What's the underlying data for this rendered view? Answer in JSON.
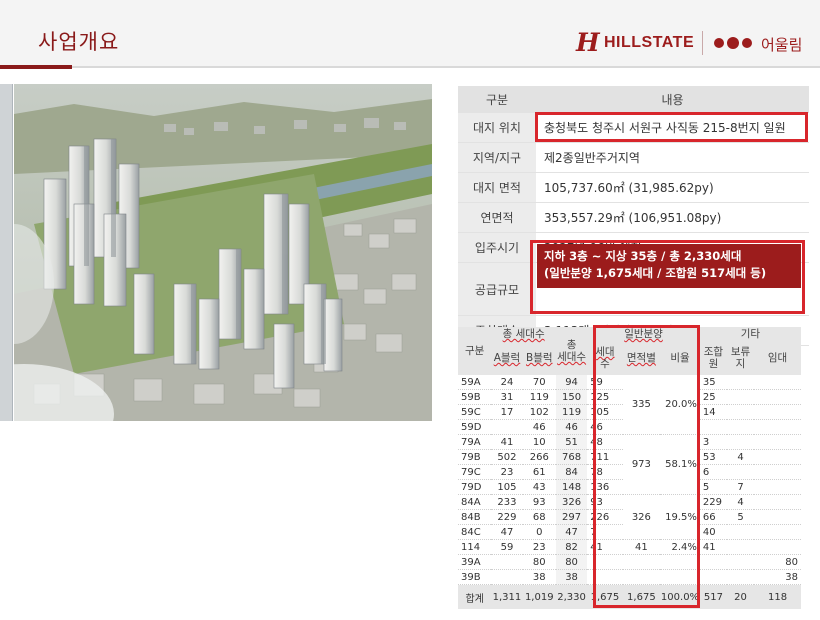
{
  "header": {
    "title": "사업개요",
    "brand_h": "H",
    "brand_name": "HILLSTATE",
    "brand_sub": "어울림",
    "brand_color": "#9c1c1c"
  },
  "info_table": {
    "head": [
      "구분",
      "내용"
    ],
    "rows": [
      {
        "label": "대지 위치",
        "value": "충청북도 청주시 서원구 사직동 215-8번지 일원"
      },
      {
        "label": "지역/지구",
        "value": "제2종일반주거지역"
      },
      {
        "label": "대지 면적",
        "value": "105,737.60㎡ (31,985.62py)"
      },
      {
        "label": "연면적",
        "value": "353,557.29㎡ (106,951.08py)"
      },
      {
        "label": "입주시기",
        "value": "2027년 06월 예정"
      },
      {
        "label": "공급규모",
        "value": "지하 3층 ~ 지상 35층 / 총 2,330세대",
        "value2": "(일반분양 1,675세대 / 조합원 517세대 등)"
      },
      {
        "label": "주차대수",
        "value": "3,113대 (세대당 1.31대)"
      }
    ]
  },
  "detail_table": {
    "head": {
      "type": "구분",
      "total_units": "총 세대수",
      "a_block": "A블럭",
      "b_block": "B블럭",
      "total": "총",
      "total2": "세대수",
      "general": "일반분양",
      "households": "세대",
      "households2": "수",
      "by_area": "면적별",
      "ratio": "비율",
      "other": "기타",
      "union": "조합",
      "union2": "원",
      "reserve": "보류",
      "reserve2": "지",
      "rental": "임대"
    },
    "rows": [
      {
        "type": "59A",
        "a": "24",
        "b": "70",
        "total": "94",
        "units": "59",
        "area": "",
        "ratio": "",
        "union": "35",
        "reserve": "",
        "rental": ""
      },
      {
        "type": "59B",
        "a": "31",
        "b": "119",
        "total": "150",
        "units": "125",
        "area": "335",
        "ratio": "20.0%",
        "union": "25",
        "reserve": "",
        "rental": ""
      },
      {
        "type": "59C",
        "a": "17",
        "b": "102",
        "total": "119",
        "units": "105",
        "area": "",
        "ratio": "",
        "union": "14",
        "reserve": "",
        "rental": ""
      },
      {
        "type": "59D",
        "a": "",
        "b": "46",
        "total": "46",
        "units": "46",
        "area": "",
        "ratio": "",
        "union": "",
        "reserve": "",
        "rental": ""
      },
      {
        "type": "79A",
        "a": "41",
        "b": "10",
        "total": "51",
        "units": "48",
        "area": "",
        "ratio": "",
        "union": "3",
        "reserve": "",
        "rental": ""
      },
      {
        "type": "79B",
        "a": "502",
        "b": "266",
        "total": "768",
        "units": "711",
        "area": "973",
        "ratio": "58.1%",
        "union": "53",
        "reserve": "4",
        "rental": ""
      },
      {
        "type": "79C",
        "a": "23",
        "b": "61",
        "total": "84",
        "units": "78",
        "area": "",
        "ratio": "",
        "union": "6",
        "reserve": "",
        "rental": ""
      },
      {
        "type": "79D",
        "a": "105",
        "b": "43",
        "total": "148",
        "units": "136",
        "area": "",
        "ratio": "",
        "union": "5",
        "reserve": "7",
        "rental": ""
      },
      {
        "type": "84A",
        "a": "233",
        "b": "93",
        "total": "326",
        "units": "93",
        "area": "",
        "ratio": "",
        "union": "229",
        "reserve": "4",
        "rental": ""
      },
      {
        "type": "84B",
        "a": "229",
        "b": "68",
        "total": "297",
        "units": "226",
        "area": "326",
        "ratio": "19.5%",
        "union": "66",
        "reserve": "5",
        "rental": ""
      },
      {
        "type": "84C",
        "a": "47",
        "b": "0",
        "total": "47",
        "units": "7",
        "area": "",
        "ratio": "",
        "union": "40",
        "reserve": "",
        "rental": ""
      },
      {
        "type": "114",
        "a": "59",
        "b": "23",
        "total": "82",
        "units": "41",
        "area": "41",
        "ratio": "2.4%",
        "union": "41",
        "reserve": "",
        "rental": ""
      },
      {
        "type": "39A",
        "a": "",
        "b": "80",
        "total": "80",
        "units": "",
        "area": "",
        "ratio": "",
        "union": "",
        "reserve": "",
        "rental": "80"
      },
      {
        "type": "39B",
        "a": "",
        "b": "38",
        "total": "38",
        "units": "",
        "area": "",
        "ratio": "",
        "union": "",
        "reserve": "",
        "rental": "38"
      }
    ],
    "total_row": {
      "type": "합계",
      "a": "1,311",
      "b": "1,019",
      "total": "2,330",
      "units": "1,675",
      "area": "1,675",
      "ratio": "100.0%",
      "union": "517",
      "reserve": "20",
      "rental": "118"
    }
  },
  "colors": {
    "highlight_border": "#d8262c",
    "supply_fill": "#9c1c1c",
    "header_accent": "#8a1a1a"
  }
}
